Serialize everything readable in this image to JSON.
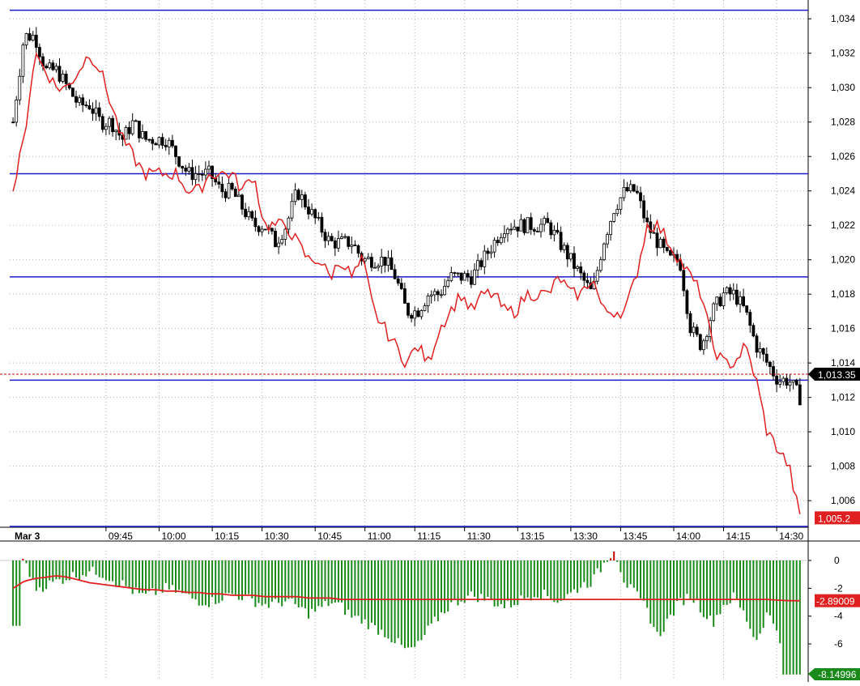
{
  "chart_data": [
    {
      "type": "candlestick",
      "panel": "price",
      "title": "",
      "xlabel": "",
      "ylabel": "",
      "ylim": [
        1.0045,
        1.035
      ],
      "y_ticks": [
        1.006,
        1.008,
        1.01,
        1.012,
        1.014,
        1.016,
        1.018,
        1.02,
        1.022,
        1.024,
        1.026,
        1.028,
        1.03,
        1.032,
        1.034
      ],
      "y_tick_labels": [
        "1,006",
        "1,008",
        "1,010",
        "1,012",
        "1,014",
        "1,016",
        "1,018",
        "1,020",
        "1,022",
        "1,024",
        "1,026",
        "1,028",
        "1,030",
        "1,032",
        "1,034"
      ],
      "x_date_label": "Mar 3",
      "x_ticks": [
        "09:45",
        "10:00",
        "10:15",
        "10:30",
        "10:45",
        "11:00",
        "11:15",
        "11:30",
        "13:15",
        "13:30",
        "13:45",
        "14:00",
        "14:15",
        "14:30"
      ],
      "x_tick_bar_index": [
        29,
        45,
        61,
        76,
        92,
        107,
        122,
        137,
        153,
        169,
        184,
        200,
        215,
        231
      ],
      "price_path": [
        1.028,
        1.033,
        1.033,
        1.031,
        1.031,
        1.03,
        1.029,
        1.029,
        1.028,
        1.028,
        1.027,
        1.028,
        1.027,
        1.027,
        1.027,
        1.026,
        1.025,
        1.025,
        1.025,
        1.024,
        1.024,
        1.023,
        1.022,
        1.022,
        1.021,
        1.022,
        1.024,
        1.023,
        1.022,
        1.021,
        1.021,
        1.021,
        1.02,
        1.02,
        1.02,
        1.019,
        1.017,
        1.017,
        1.018,
        1.018,
        1.019,
        1.019,
        1.019,
        1.02,
        1.021,
        1.022,
        1.022,
        1.022,
        1.022,
        1.022,
        1.021,
        1.02,
        1.019,
        1.018,
        1.021,
        1.023,
        1.024,
        1.024,
        1.022,
        1.021,
        1.02,
        1.02,
        1.016,
        1.015,
        1.017,
        1.018,
        1.018,
        1.017,
        1.015,
        1.014,
        1.013,
        1.013,
        1.012
      ],
      "horizontal_lines": [
        1.0345,
        1.025,
        1.019,
        1.013,
        1.0045
      ],
      "current_price_label": "1,013.35",
      "current_price": 1.01335,
      "line_overlay_color": "#e02020",
      "line_overlay_path": [
        1.024,
        1.027,
        1.032,
        1.031,
        1.03,
        1.03,
        1.031,
        1.032,
        1.031,
        1.029,
        1.027,
        1.026,
        1.025,
        1.025,
        1.025,
        1.025,
        1.024,
        1.024,
        1.025,
        1.025,
        1.025,
        1.024,
        1.025,
        1.022,
        1.022,
        1.022,
        1.021,
        1.02,
        1.02,
        1.019,
        1.02,
        1.019,
        1.02,
        1.017,
        1.016,
        1.015,
        1.014,
        1.015,
        1.014,
        1.016,
        1.017,
        1.018,
        1.017,
        1.018,
        1.018,
        1.017,
        1.017,
        1.018,
        1.018,
        1.018,
        1.019,
        1.018,
        1.018,
        1.019,
        1.017,
        1.017,
        1.017,
        1.019,
        1.022,
        1.022,
        1.021,
        1.02,
        1.019,
        1.018,
        1.015,
        1.014,
        1.014,
        1.015,
        1.013,
        1.01,
        1.009,
        1.008,
        1.005
      ],
      "line_overlay_label": "1,005.2"
    },
    {
      "type": "bar",
      "panel": "indicator",
      "title": "",
      "ylim": [
        -8.5,
        0.7
      ],
      "y_ticks": [
        0,
        -2,
        -4,
        -6
      ],
      "y_tick_labels": [
        "0",
        "-2",
        "-4",
        "-6"
      ],
      "bar_color": "#1a8a1a",
      "positive_bar_color": "#cc0000",
      "bar_values": [
        -4.7,
        0.3,
        -2.0,
        -1.8,
        -1.5,
        -1.2,
        -1.0,
        -0.8,
        -0.9,
        -1.3,
        -1.7,
        -2.2,
        -2.6,
        -2.3,
        -2.0,
        -2.2,
        -2.6,
        -2.9,
        -3.0,
        -2.7,
        -2.4,
        -2.6,
        -2.9,
        -3.2,
        -3.1,
        -2.9,
        -3.3,
        -3.8,
        -3.5,
        -3.0,
        -3.3,
        -4.0,
        -4.3,
        -4.8,
        -5.2,
        -5.8,
        -6.5,
        -6.2,
        -5.0,
        -4.0,
        -3.2,
        -2.8,
        -2.5,
        -2.7,
        -3.0,
        -3.3,
        -3.0,
        -2.6,
        -2.3,
        -2.6,
        -2.9,
        -2.4,
        -1.8,
        -1.5,
        -0.3,
        0.9,
        -1.6,
        -2.5,
        -3.5,
        -5.5,
        -4.2,
        -3.0,
        -2.5,
        -3.5,
        -4.5,
        -3.2,
        -2.6,
        -4.0,
        -5.8,
        -3.8,
        -5.0,
        -8.2,
        -8.2
      ],
      "signal_color": "#e02020",
      "signal_path": [
        -2.0,
        -1.5,
        -1.3,
        -1.2,
        -1.1,
        -1.2,
        -1.4,
        -1.6,
        -1.7,
        -1.8,
        -1.9,
        -2.0,
        -2.1,
        -2.1,
        -2.2,
        -2.2,
        -2.3,
        -2.3,
        -2.4,
        -2.4,
        -2.5,
        -2.5,
        -2.5,
        -2.6,
        -2.6,
        -2.6,
        -2.6,
        -2.7,
        -2.7,
        -2.7,
        -2.8,
        -2.8,
        -2.8,
        -2.8,
        -2.8,
        -2.8,
        -2.8,
        -2.8,
        -2.8,
        -2.8,
        -2.8,
        -2.8,
        -2.8,
        -2.8,
        -2.8,
        -2.8,
        -2.8,
        -2.8,
        -2.8,
        -2.8,
        -2.8,
        -2.8,
        -2.8,
        -2.8,
        -2.8,
        -2.8,
        -2.8,
        -2.8,
        -2.8,
        -2.8,
        -2.8,
        -2.8,
        -2.8,
        -2.8,
        -2.8,
        -2.8,
        -2.8,
        -2.8,
        -2.8,
        -2.8,
        -2.85,
        -2.89,
        -2.89
      ],
      "signal_label": "-2.89009",
      "value_label": "-8.14996"
    }
  ]
}
